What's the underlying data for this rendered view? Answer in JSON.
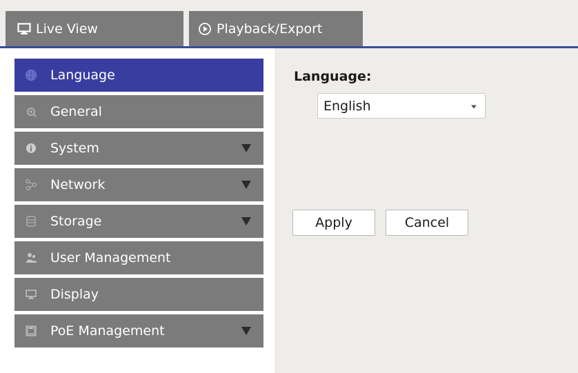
{
  "tabs": [
    {
      "label": "Live View",
      "icon": "monitor-icon"
    },
    {
      "label": "Playback/Export",
      "icon": "play-circle-icon"
    }
  ],
  "sidebar": {
    "items": [
      {
        "label": "Language",
        "icon": "globe-icon",
        "active": true,
        "expandable": false
      },
      {
        "label": "General",
        "icon": "gear-icon",
        "active": false,
        "expandable": false
      },
      {
        "label": "System",
        "icon": "info-icon",
        "active": false,
        "expandable": true
      },
      {
        "label": "Network",
        "icon": "network-icon",
        "active": false,
        "expandable": true
      },
      {
        "label": "Storage",
        "icon": "storage-icon",
        "active": false,
        "expandable": true
      },
      {
        "label": "User Management",
        "icon": "users-icon",
        "active": false,
        "expandable": false
      },
      {
        "label": "Display",
        "icon": "display-icon",
        "active": false,
        "expandable": false
      },
      {
        "label": "PoE Management",
        "icon": "poe-icon",
        "active": false,
        "expandable": true
      }
    ]
  },
  "main": {
    "language_label": "Language:",
    "language_selected": "English",
    "apply_label": "Apply",
    "cancel_label": "Cancel"
  },
  "colors": {
    "accent": "#3a3da0",
    "tab_underline": "#3a4b98",
    "tab_bg": "#7b7b7b",
    "sidebar_item_bg": "#7b7b7b",
    "panel_bg": "#efedea"
  }
}
